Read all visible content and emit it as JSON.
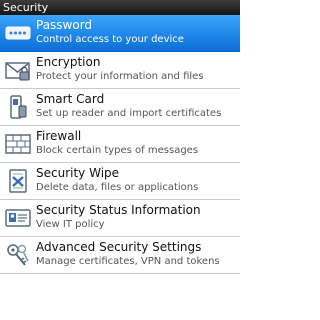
{
  "header": {
    "title": "Security"
  },
  "items": [
    {
      "label": "Password",
      "desc": "Control access to your device",
      "icon": "password-icon"
    },
    {
      "label": "Encryption",
      "desc": "Protect your information and files",
      "icon": "envelope-lock-icon"
    },
    {
      "label": "Smart Card",
      "desc": "Set up reader and import certificates",
      "icon": "smart-card-icon"
    },
    {
      "label": "Firewall",
      "desc": "Block certain types of messages",
      "icon": "firewall-icon"
    },
    {
      "label": "Security Wipe",
      "desc": "Delete data, files or applications",
      "icon": "wipe-icon"
    },
    {
      "label": "Security Status Information",
      "desc": "View IT policy",
      "icon": "id-card-icon"
    },
    {
      "label": "Advanced Security Settings",
      "desc": "Manage certificates, VPN and tokens",
      "icon": "keys-icon"
    }
  ],
  "colors": {
    "selection": "#1a87f0",
    "title_bar": "#1f1f1f"
  }
}
